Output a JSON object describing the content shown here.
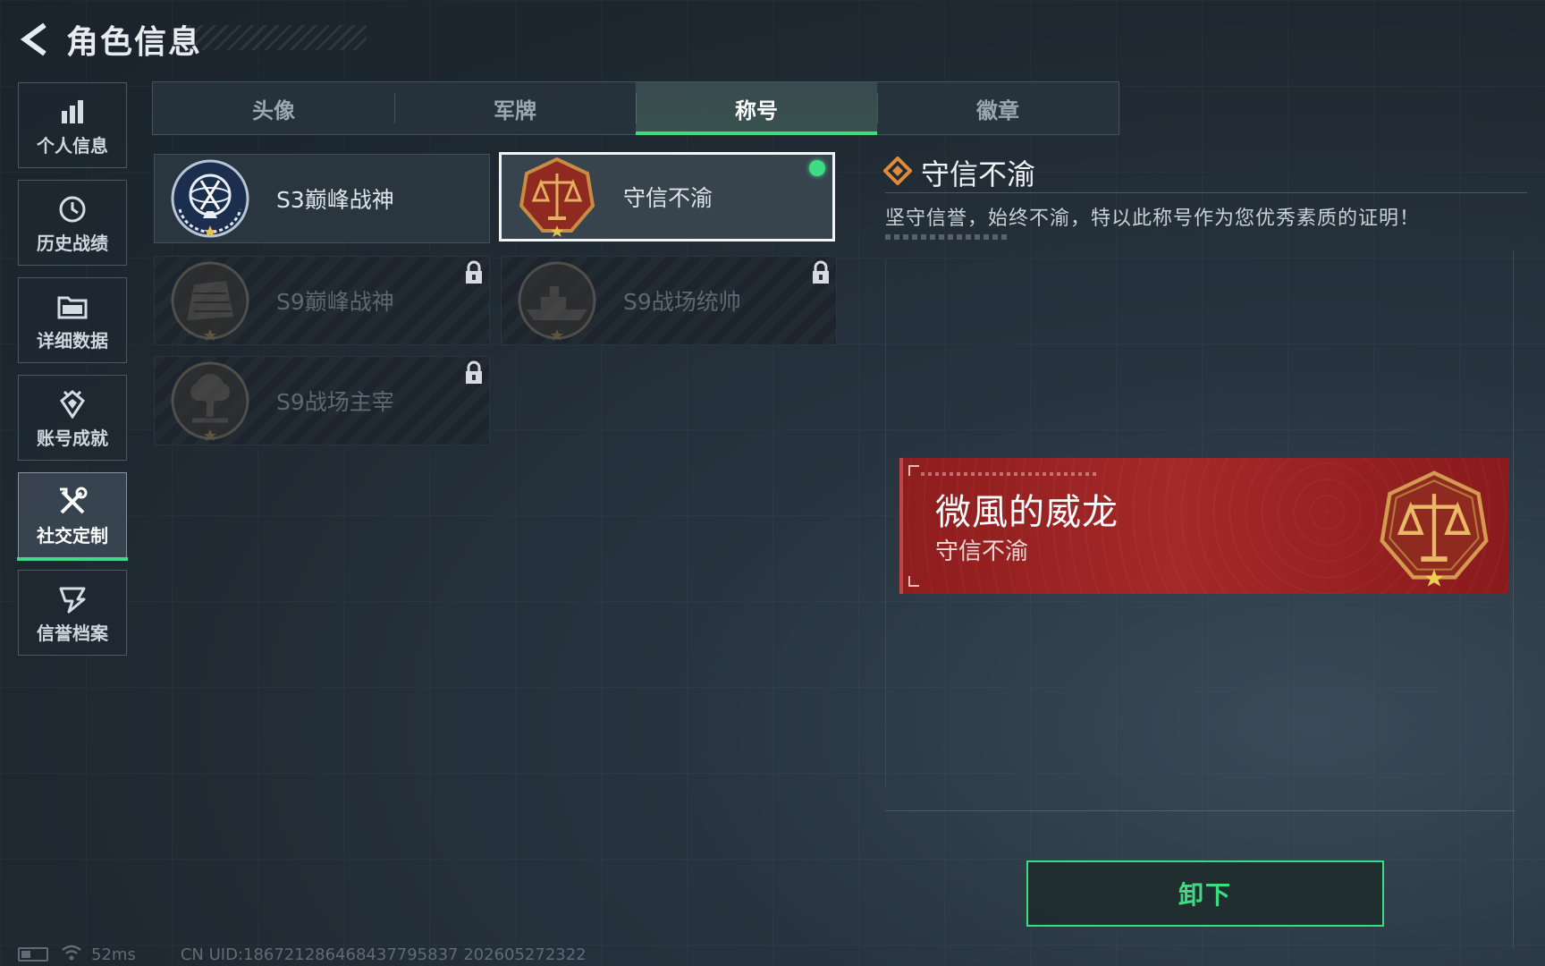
{
  "header": {
    "title": "角色信息",
    "back_icon": "chevron-left-icon"
  },
  "sidebar": {
    "items": [
      {
        "label": "个人信息",
        "icon": "bar-chart-icon",
        "active": false
      },
      {
        "label": "历史战绩",
        "icon": "history-icon",
        "active": false
      },
      {
        "label": "详细数据",
        "icon": "folder-icon",
        "active": false
      },
      {
        "label": "账号成就",
        "icon": "achievement-icon",
        "active": false
      },
      {
        "label": "社交定制",
        "icon": "tools-icon",
        "active": true
      },
      {
        "label": "信誉档案",
        "icon": "credit-icon",
        "active": false
      }
    ]
  },
  "tabs": [
    {
      "label": "头像",
      "active": false
    },
    {
      "label": "军牌",
      "active": false
    },
    {
      "label": "称号",
      "active": true
    },
    {
      "label": "徽章",
      "active": false
    }
  ],
  "titles": [
    {
      "name": "S3巅峰战神",
      "emblem": "globe-emblem-icon",
      "locked": false,
      "selected": false
    },
    {
      "name": "守信不渝",
      "emblem": "scales-emblem-icon",
      "locked": false,
      "selected": true,
      "equipped": true
    },
    {
      "name": "S9巅峰战神",
      "emblem": "fortress-emblem-icon",
      "locked": true,
      "selected": false
    },
    {
      "name": "S9战场统帅",
      "emblem": "battleship-emblem-icon",
      "locked": true,
      "selected": false
    },
    {
      "name": "S9战场主宰",
      "emblem": "explosion-emblem-icon",
      "locked": true,
      "selected": false
    }
  ],
  "detail": {
    "title": "守信不渝",
    "description": "坚守信誉，始终不渝，特以此称号作为您优秀素质的证明！"
  },
  "preview": {
    "player_name": "微風的威龙",
    "title": "守信不渝"
  },
  "actions": {
    "unequip_label": "卸下"
  },
  "status_bar": {
    "ping": "52ms",
    "uid": "CN UID:18672128646843779583​7 202605272322"
  },
  "colors": {
    "accent": "#3ddc84",
    "banner": "#a52828"
  }
}
